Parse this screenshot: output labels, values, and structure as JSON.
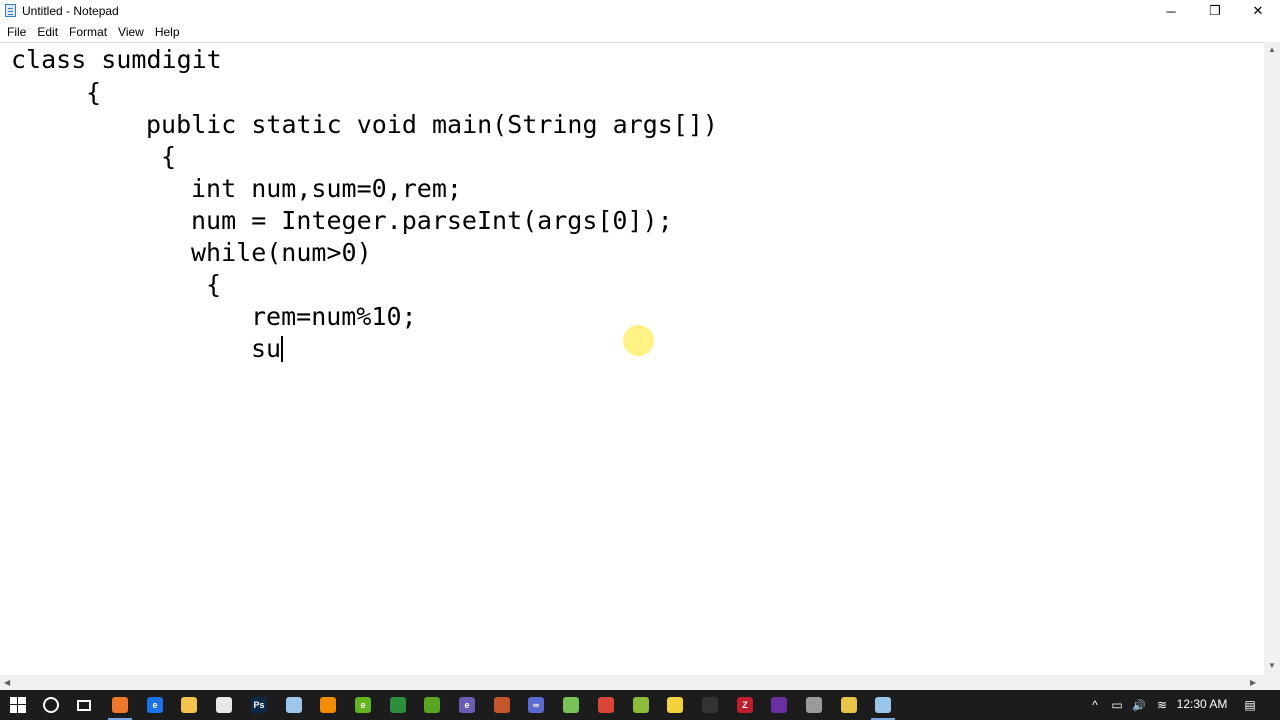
{
  "window": {
    "title": "Untitled - Notepad",
    "controls": {
      "minimize": "─",
      "restore": "❐",
      "close": "✕"
    }
  },
  "menu": {
    "items": [
      "File",
      "Edit",
      "Format",
      "View",
      "Help"
    ]
  },
  "editor": {
    "lines": [
      "class sumdigit",
      "{",
      "public static void main(String args[])",
      "{",
      "int num,sum=0,rem;",
      "num = Integer.parseInt(args[0]);",
      "while(num>0)",
      "{",
      "rem=num%10;",
      "su"
    ]
  },
  "taskbar": {
    "icons": [
      {
        "name": "orange-app-icon",
        "color": "#f0792b",
        "glyph": ""
      },
      {
        "name": "edge-icon",
        "color": "#1a73e8",
        "glyph": "e"
      },
      {
        "name": "file-explorer-icon",
        "color": "#f2c14e",
        "glyph": ""
      },
      {
        "name": "store-icon",
        "color": "#e8e8e8",
        "glyph": ""
      },
      {
        "name": "photoshop-icon",
        "color": "#0b2a4a",
        "glyph": "Ps"
      },
      {
        "name": "cube-icon",
        "color": "#9ec7ee",
        "glyph": ""
      },
      {
        "name": "vlc-icon",
        "color": "#f28c00",
        "glyph": ""
      },
      {
        "name": "green-e-icon",
        "color": "#62b420",
        "glyph": "e"
      },
      {
        "name": "eclipse-icon",
        "color": "#2d8f3e",
        "glyph": ""
      },
      {
        "name": "green-circle-icon",
        "color": "#58a521",
        "glyph": ""
      },
      {
        "name": "e-globe-icon",
        "color": "#6b5db3",
        "glyph": "e"
      },
      {
        "name": "archive-icon",
        "color": "#c4562b",
        "glyph": ""
      },
      {
        "name": "infinity-icon",
        "color": "#5b6ad3",
        "glyph": "∞"
      },
      {
        "name": "android-icon",
        "color": "#78c257",
        "glyph": ""
      },
      {
        "name": "chrome-icon",
        "color": "#dc4437",
        "glyph": ""
      },
      {
        "name": "stack-icon",
        "color": "#8dbb3a",
        "glyph": ""
      },
      {
        "name": "sticky-notes-icon",
        "color": "#f3d33d",
        "glyph": ""
      },
      {
        "name": "dark-app-icon",
        "color": "#333333",
        "glyph": ""
      },
      {
        "name": "filezilla-icon",
        "color": "#bf1e2d",
        "glyph": "Z"
      },
      {
        "name": "visual-studio-icon",
        "color": "#6a2fa0",
        "glyph": ""
      },
      {
        "name": "tool-icon",
        "color": "#9a9a9a",
        "glyph": ""
      },
      {
        "name": "paint-icon",
        "color": "#e8c44b",
        "glyph": ""
      },
      {
        "name": "notepad-icon",
        "color": "#9ac6e8",
        "glyph": ""
      }
    ],
    "tray": {
      "chevron": "^",
      "battery": "▭",
      "volume": "🔊",
      "wifi": "≋",
      "notifications": "▤"
    },
    "clock": "12:30 AM"
  }
}
